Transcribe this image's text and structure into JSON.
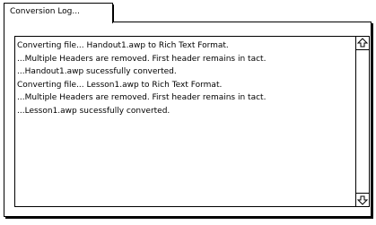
{
  "tab": {
    "label": "Conversion Log..."
  },
  "log": {
    "lines": [
      "Converting file... Handout1.awp to Rich Text Format.",
      "...Multiple Headers are removed.  First header remains in tact.",
      "...Handout1.awp sucessfully converted.",
      "Converting file... Lesson1.awp to Rich Text Format.",
      "...Multiple Headers are removed.  First header remains in tact.",
      "...Lesson1.awp sucessfully converted."
    ]
  },
  "icons": {
    "scroll_up": "up-arrow-icon",
    "scroll_down": "down-arrow-icon"
  }
}
